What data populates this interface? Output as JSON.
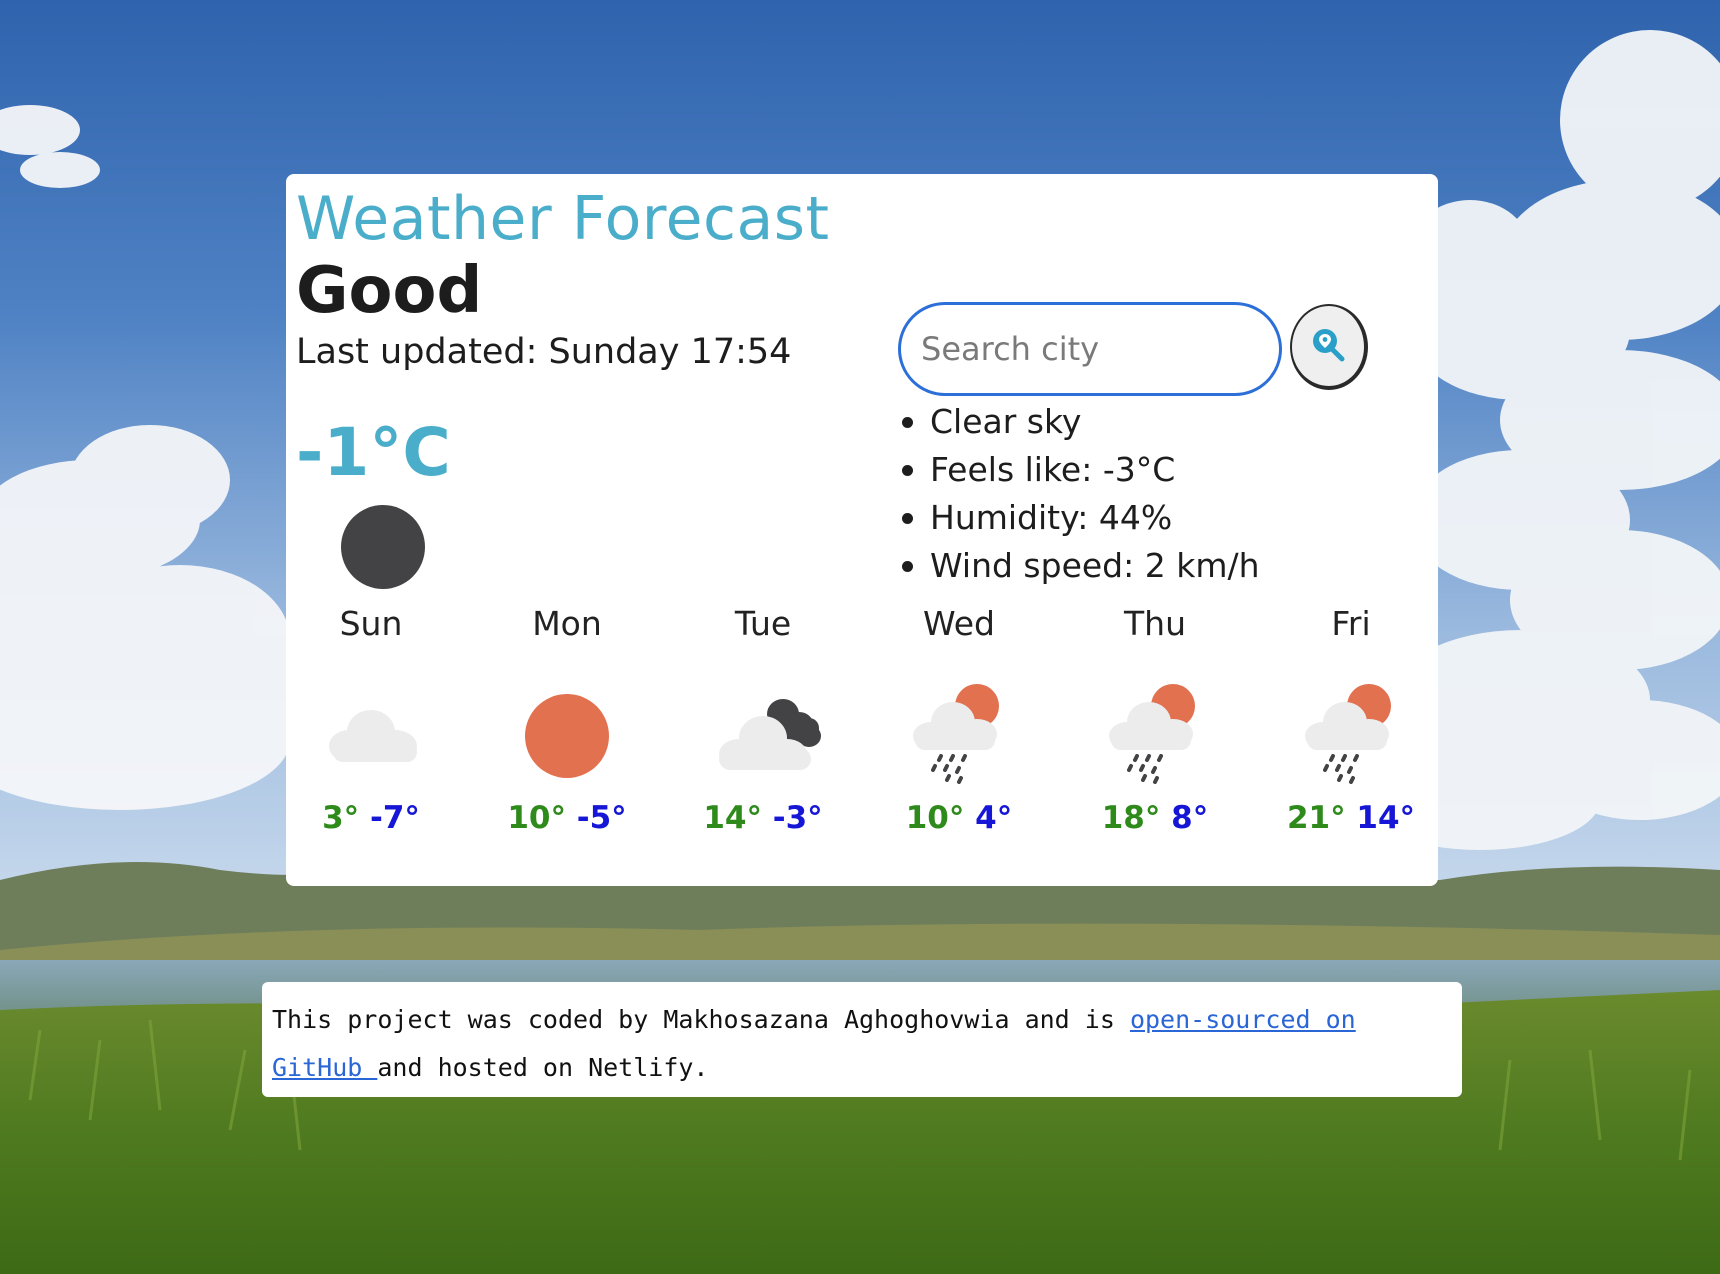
{
  "app": {
    "title": "Weather Forecast",
    "city": "Good",
    "last_updated": "Last updated: Sunday 17:54",
    "temperature": "-1°C",
    "current_icon": "dark-circle-icon"
  },
  "search": {
    "placeholder": "Search city",
    "button_icon": "location-search-icon"
  },
  "details": [
    "Clear sky",
    "Feels like: -3°C",
    "Humidity: 44%",
    "Wind speed: 2 km/h"
  ],
  "forecast": [
    {
      "day": "Sun",
      "max": "3°",
      "min": "-7°",
      "icon": "cloud-icon"
    },
    {
      "day": "Mon",
      "max": "10°",
      "min": "-5°",
      "icon": "sun-icon"
    },
    {
      "day": "Tue",
      "max": "14°",
      "min": "-3°",
      "icon": "cloudy-dark-icon"
    },
    {
      "day": "Wed",
      "max": "10°",
      "min": "4°",
      "icon": "sun-rain-icon"
    },
    {
      "day": "Thu",
      "max": "18°",
      "min": "8°",
      "icon": "sun-rain-icon"
    },
    {
      "day": "Fri",
      "max": "21°",
      "min": "14°",
      "icon": "sun-rain-icon"
    }
  ],
  "footer": {
    "text_before": "This project was coded by Makhosazana Aghoghovwia and is ",
    "link_text": "open-sourced on GitHub ",
    "text_after": "and hosted on Netlify."
  },
  "colors": {
    "accent": "#4aaecb",
    "max_temp": "#2f8a1c",
    "min_temp": "#1616d6",
    "link": "#2a66d6",
    "search_border": "#2d6fd9"
  }
}
